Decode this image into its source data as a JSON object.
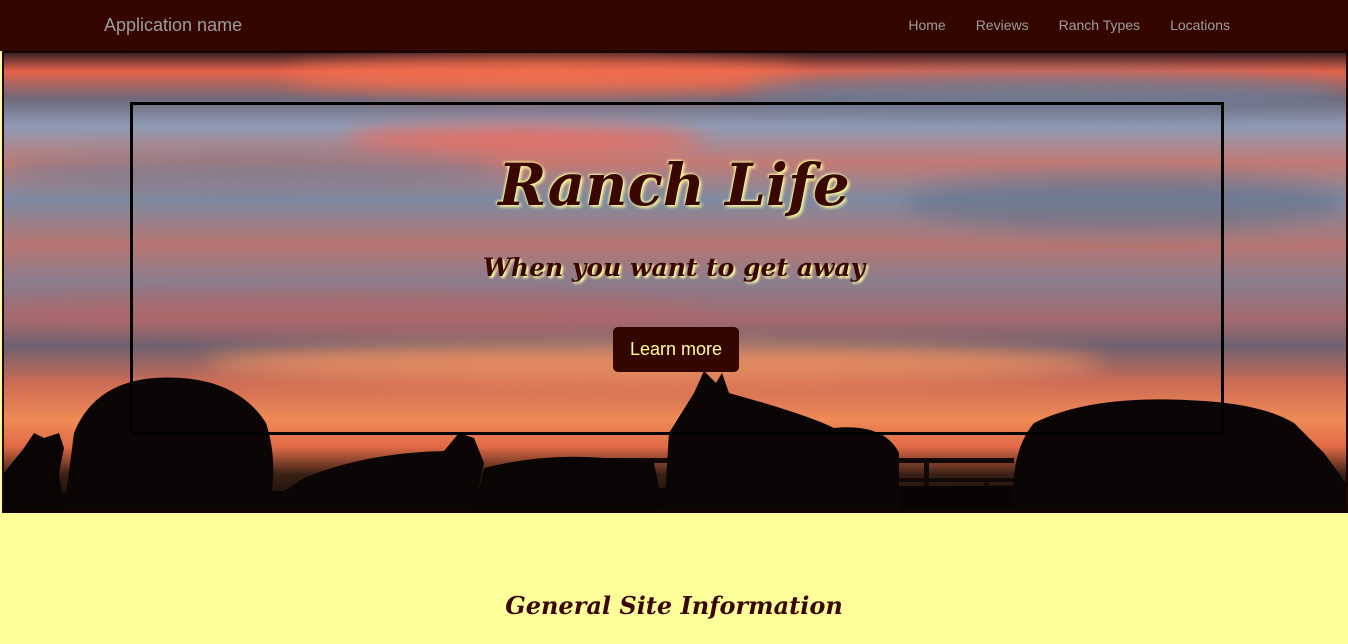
{
  "navbar": {
    "brand": "Application name",
    "links": [
      "Home",
      "Reviews",
      "Ranch Types",
      "Locations"
    ]
  },
  "hero": {
    "title": "Ranch Life",
    "subtitle": "When you want to get away",
    "button_label": "Learn more"
  },
  "main": {
    "section_title": "General Site Information"
  },
  "colors": {
    "navbar_bg": "#350600",
    "accent_text": "#3a0600",
    "page_bg": "#ffff99",
    "button_text": "#ffff99"
  }
}
